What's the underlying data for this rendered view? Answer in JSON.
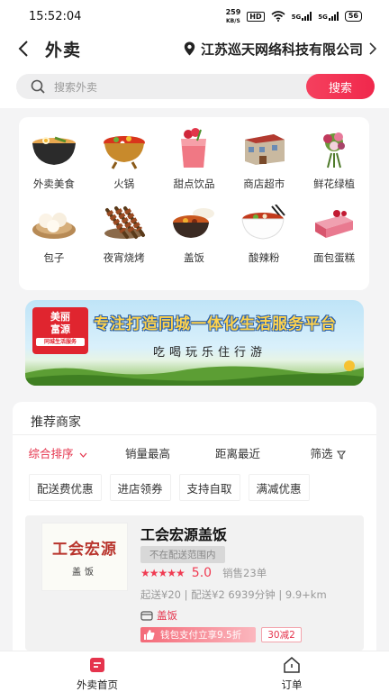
{
  "status_bar": {
    "time": "15:52:04",
    "net_speed": "259",
    "net_unit": "KB/S",
    "hd": "HD",
    "sim1": "5G",
    "sim2": "5G",
    "battery": "56"
  },
  "header": {
    "back_icon": "chevron-left-icon",
    "title": "外卖",
    "location_icon": "map-pin-icon",
    "location": "江苏巡天网络科技有限公司",
    "location_arrow_icon": "chevron-right-icon"
  },
  "search": {
    "icon": "search-icon",
    "placeholder": "搜索外卖",
    "button_label": "搜索",
    "button_color": "#f0284c"
  },
  "categories": [
    {
      "label": "外卖美食",
      "icon": "noodle-bowl-icon"
    },
    {
      "label": "火锅",
      "icon": "hotpot-icon"
    },
    {
      "label": "甜点饮品",
      "icon": "drink-cup-icon"
    },
    {
      "label": "商店超市",
      "icon": "store-icon"
    },
    {
      "label": "鲜花绿植",
      "icon": "flower-bouquet-icon"
    },
    {
      "label": "包子",
      "icon": "steamed-bun-icon"
    },
    {
      "label": "夜宵烧烤",
      "icon": "skewer-icon"
    },
    {
      "label": "盖饭",
      "icon": "rice-pot-icon"
    },
    {
      "label": "酸辣粉",
      "icon": "spicy-noodles-icon"
    },
    {
      "label": "面包蛋糕",
      "icon": "cake-icon"
    }
  ],
  "banner": {
    "logo_line1": "美丽",
    "logo_line2": "富源",
    "logo_sub": "同城生活服务",
    "title": "专注打造同城一体化生活服务平台",
    "subtitle": "吃喝玩乐住行游"
  },
  "merchants": {
    "title": "推荐商家",
    "sort_tabs": [
      {
        "label": "综合排序",
        "active": true
      },
      {
        "label": "销量最高",
        "active": false
      },
      {
        "label": "距离最近",
        "active": false
      },
      {
        "label": "筛选",
        "active": false
      }
    ],
    "chips": [
      "配送费优惠",
      "进店领券",
      "支持自取",
      "满减优惠"
    ],
    "accent": "#e5344d"
  },
  "shop": {
    "image_text_big": "工会宏源",
    "image_text_small": "盖饭",
    "name": "工会宏源盖饭",
    "range_tag": "不在配送范围内",
    "stars": "★★★★★",
    "rating": "5.0",
    "monthly_sales": "销售23单",
    "delivery_info": "起送¥20 | 配送¥2   6939分钟 | 9.9+km",
    "category_icon": "shop-icon",
    "category": "盖饭",
    "promo_pay": "钱包支付立享9.5折",
    "promo_reduce": "30减2"
  },
  "bottom_nav": [
    {
      "label": "外卖首页",
      "icon": "home-doc-icon",
      "active": true
    },
    {
      "label": "订单",
      "icon": "order-house-icon",
      "active": false
    }
  ]
}
